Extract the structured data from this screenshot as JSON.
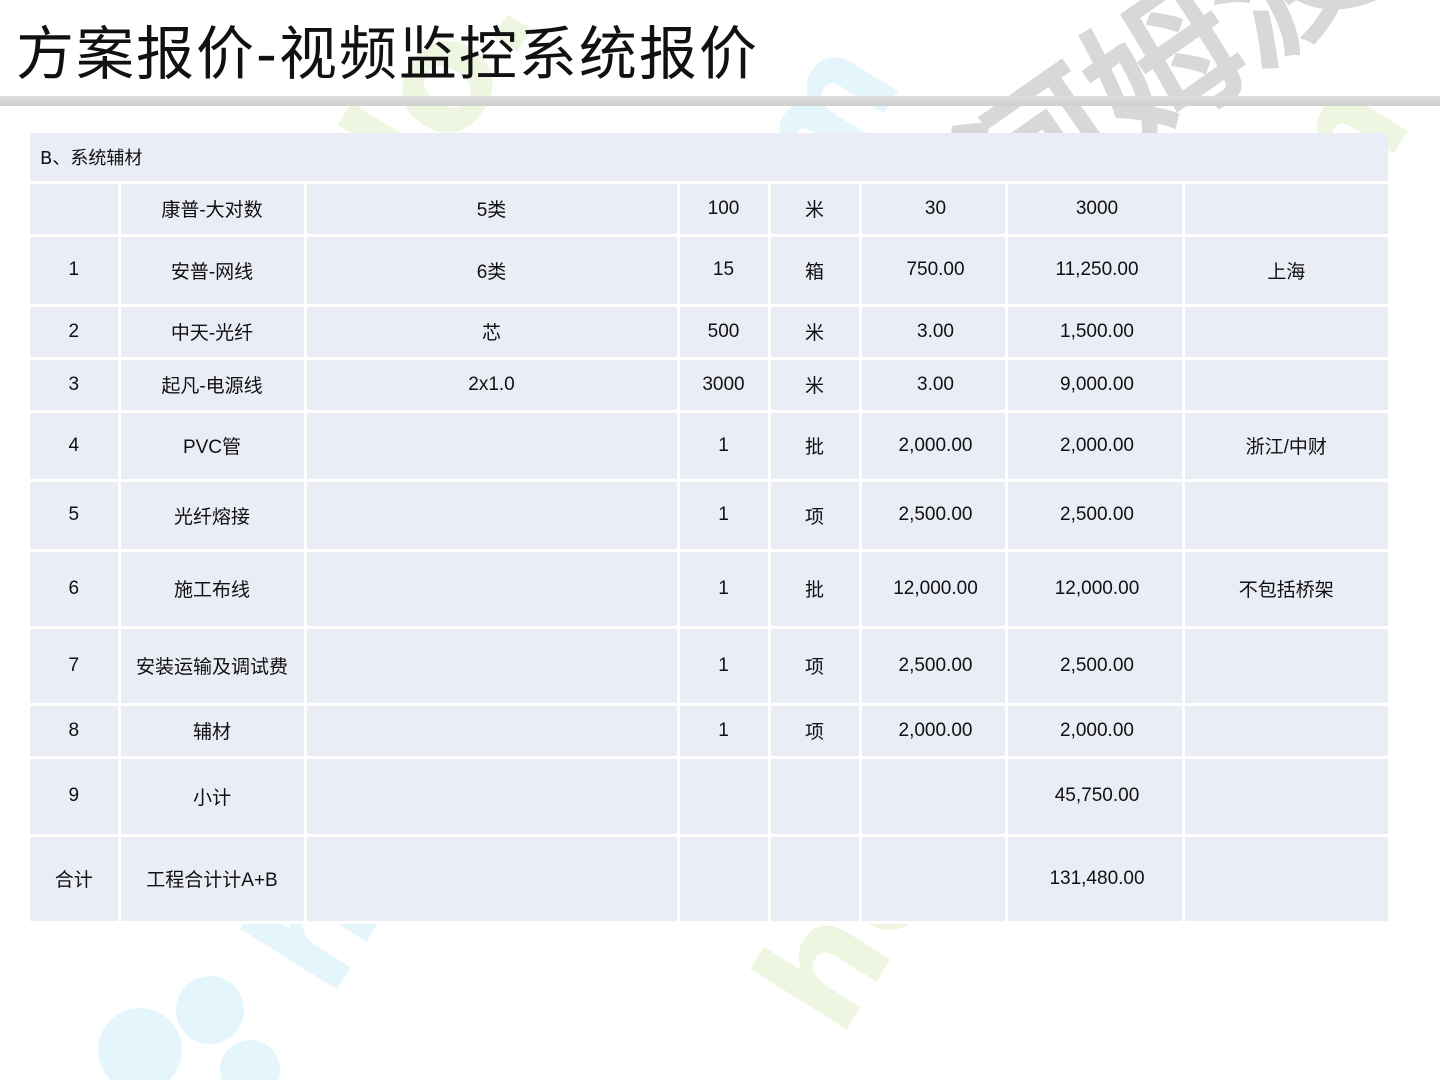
{
  "page": {
    "title": "方案报价-视频监控系统报价",
    "section": "B、系统辅材"
  },
  "watermark": {
    "text": "homedo.com",
    "brand": "河姆渡",
    "colors": {
      "green": "#eef6e2",
      "cyan": "#e4f6fb",
      "gray": "#d8d8d8"
    }
  },
  "table": {
    "rows": [
      {
        "no": "",
        "name": "康普-大对数",
        "spec": "5类",
        "qty": "100",
        "unit": "米",
        "price": "30",
        "total": "3000",
        "note": ""
      },
      {
        "no": "1",
        "name": "安普-网线",
        "spec": "6类",
        "qty": "15",
        "unit": "箱",
        "price": "750.00",
        "total": "11,250.00",
        "note": "上海"
      },
      {
        "no": "2",
        "name": "中天-光纤",
        "spec": "芯",
        "qty": "500",
        "unit": "米",
        "price": "3.00",
        "total": "1,500.00",
        "note": ""
      },
      {
        "no": "3",
        "name": "起凡-电源线",
        "spec": "2x1.0",
        "qty": "3000",
        "unit": "米",
        "price": "3.00",
        "total": "9,000.00",
        "note": ""
      },
      {
        "no": "4",
        "name": "PVC管",
        "spec": "",
        "qty": "1",
        "unit": "批",
        "price": "2,000.00",
        "total": "2,000.00",
        "note": "浙江/中财"
      },
      {
        "no": "5",
        "name": "光纤熔接",
        "spec": "",
        "qty": "1",
        "unit": "项",
        "price": "2,500.00",
        "total": "2,500.00",
        "note": ""
      },
      {
        "no": "6",
        "name": "施工布线",
        "spec": "",
        "qty": "1",
        "unit": "批",
        "price": "12,000.00",
        "total": "12,000.00",
        "note": "不包括桥架"
      },
      {
        "no": "7",
        "name": "安装运输及调试费",
        "spec": "",
        "qty": "1",
        "unit": "项",
        "price": "2,500.00",
        "total": "2,500.00",
        "note": ""
      },
      {
        "no": "8",
        "name": "辅材",
        "spec": "",
        "qty": "1",
        "unit": "项",
        "price": "2,000.00",
        "total": "2,000.00",
        "note": ""
      },
      {
        "no": "9",
        "name": "小计",
        "spec": "",
        "qty": "",
        "unit": "",
        "price": "",
        "total": "45,750.00",
        "note": ""
      },
      {
        "no": "合计",
        "name": "工程合计计A+B",
        "spec": "",
        "qty": "",
        "unit": "",
        "price": "",
        "total": "131,480.00",
        "note": ""
      }
    ]
  }
}
